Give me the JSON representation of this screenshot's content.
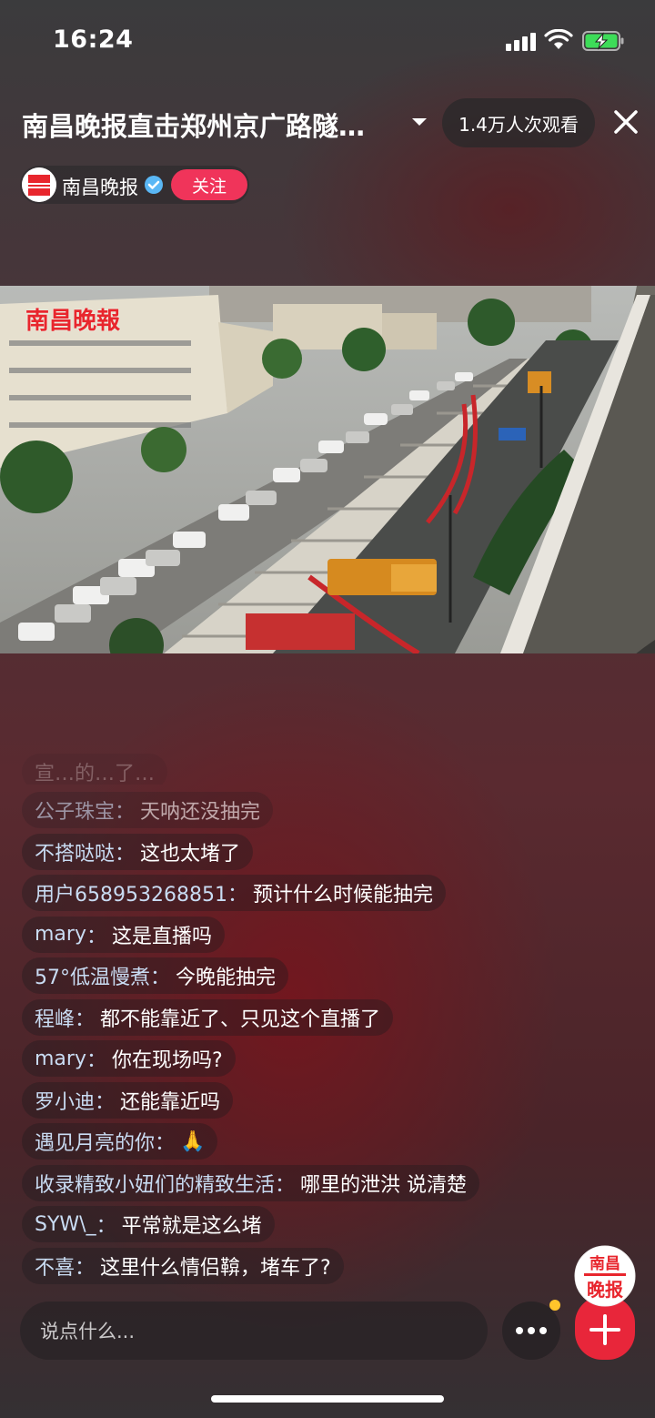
{
  "status_bar": {
    "time": "16:24"
  },
  "header": {
    "title": "南昌晚报直击郑州京广路隧…",
    "viewers": "1.4万人次观看",
    "host_name": "南昌晚报",
    "follow_label": "关注"
  },
  "video": {
    "watermark": "南昌晚報"
  },
  "chat": {
    "faded_text": "宣…的…了…",
    "messages": [
      {
        "user": "公子珠宝",
        "text": "天呐还没抽完"
      },
      {
        "user": "不搭哒哒",
        "text": "这也太堵了"
      },
      {
        "user": "用户658953268851",
        "text": "预计什么时候能抽完"
      },
      {
        "user": "mary",
        "text": "这是直播吗"
      },
      {
        "user": "57°低温慢煮",
        "text": "今晚能抽完"
      },
      {
        "user": "程峰",
        "text": "都不能靠近了、只见这个直播了"
      },
      {
        "user": "mary",
        "text": "你在现场吗?"
      },
      {
        "user": "罗小迪",
        "text": "还能靠近吗"
      },
      {
        "user": "遇见月亮的你",
        "text": "🙏"
      },
      {
        "user": "收录精致小妞们的精致生活",
        "text": "哪里的泄洪 说清楚"
      },
      {
        "user": "SYW\\_",
        "text": "平常就是这么堵"
      },
      {
        "user": "不喜",
        "text": "这里什么情侣鞥，堵车了?"
      }
    ]
  },
  "bottom_bar": {
    "comment_placeholder": "说点什么...",
    "gift_logo_line1": "南昌",
    "gift_logo_line2": "晚报"
  },
  "colors": {
    "follow": "#f0345a",
    "accent_dot": "#ffc52b",
    "chat_user": "#c9dcf3",
    "gift_button": "#e8263a"
  }
}
